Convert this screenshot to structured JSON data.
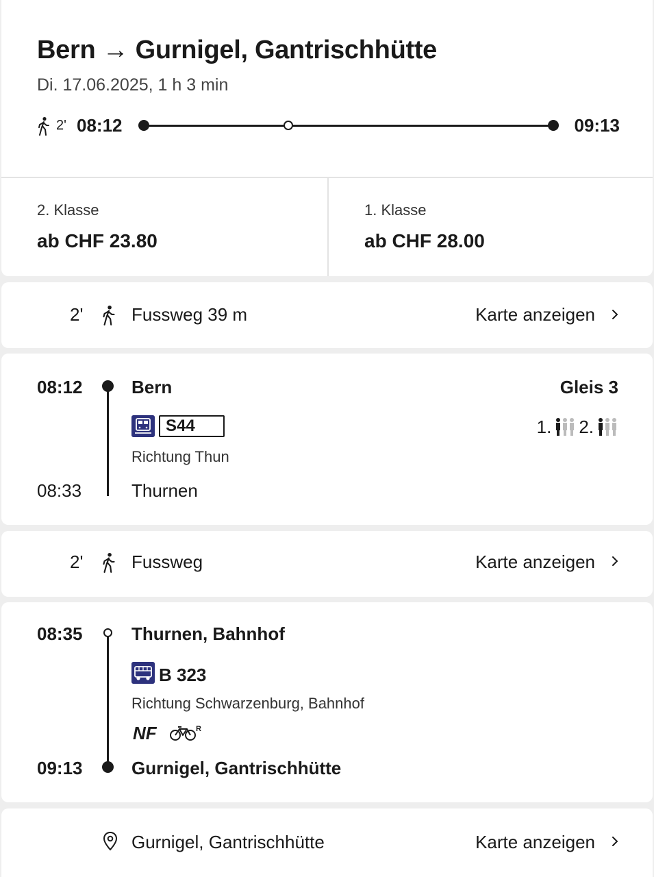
{
  "header": {
    "from": "Bern",
    "arrow": "→",
    "to": "Gurnigel, Gantrischhütte",
    "subtitle": "Di. 17.06.2025, 1 h 3 min",
    "walk_minutes": "2'",
    "departure": "08:12",
    "arrival": "09:13"
  },
  "prices": [
    {
      "class_label": "2. Klasse",
      "price": "ab CHF 23.80"
    },
    {
      "class_label": "1. Klasse",
      "price": "ab CHF 28.00"
    }
  ],
  "walk1": {
    "minutes": "2'",
    "text": "Fussweg 39 m",
    "link": "Karte anzeigen"
  },
  "leg1": {
    "dep_time": "08:12",
    "dep_stop": "Bern",
    "platform": "Gleis 3",
    "product_icon": "train-icon",
    "line": "S44",
    "occ_first": "1.",
    "occ_second": "2.",
    "direction": "Richtung Thun",
    "arr_time": "08:33",
    "arr_stop": "Thurnen"
  },
  "walk2": {
    "minutes": "2'",
    "text": "Fussweg",
    "link": "Karte anzeigen"
  },
  "leg2": {
    "dep_time": "08:35",
    "dep_stop": "Thurnen, Bahnhof",
    "product_icon": "bus-icon",
    "line": "B 323",
    "direction": "Richtung Schwarzenburg, Bahnhof",
    "attr_nf": "NF",
    "attr_bike": "bike-reservation-icon",
    "arr_time": "09:13",
    "arr_stop": "Gurnigel, Gantrischhütte"
  },
  "destination": {
    "icon": "location-pin-icon",
    "text": "Gurnigel, Gantrischhütte",
    "link": "Karte anzeigen"
  },
  "colors": {
    "brand_blue": "#2d327d",
    "text": "#1a1a1a",
    "background": "#eeeeee"
  }
}
